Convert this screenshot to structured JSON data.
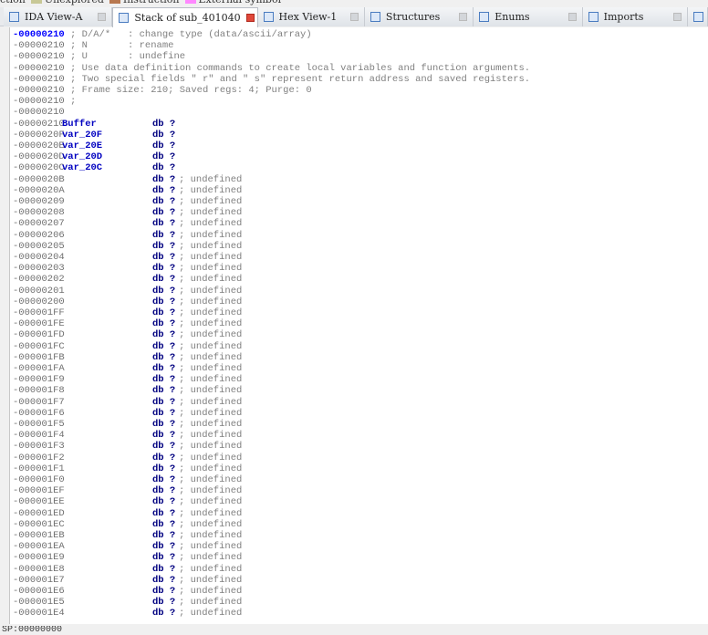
{
  "legend": [
    {
      "label": "ction",
      "color": ""
    },
    {
      "label": "Unexplored",
      "color": "#c8c896"
    },
    {
      "label": "Instruction",
      "color": "#b87850"
    },
    {
      "label": "External symbol",
      "color": "#ff88ff"
    }
  ],
  "tabs": [
    {
      "label": "IDA View-A",
      "active": false
    },
    {
      "label": "Stack of sub_401040",
      "active": true
    },
    {
      "label": "Hex View-1",
      "active": false
    },
    {
      "label": "Structures",
      "active": false
    },
    {
      "label": "Enums",
      "active": false
    },
    {
      "label": "Imports",
      "active": false
    },
    {
      "label": "",
      "active": false
    }
  ],
  "header_lines": [
    {
      "addr": "-00000210",
      "text": " ; D/A/*   : change type (data/ascii/array)"
    },
    {
      "addr": "-00000210",
      "text": " ; N       : rename"
    },
    {
      "addr": "-00000210",
      "text": " ; U       : undefine"
    },
    {
      "addr": "-00000210",
      "text": " ; Use data definition commands to create local variables and function arguments."
    },
    {
      "addr": "-00000210",
      "text": " ; Two special fields \" r\" and \" s\" represent return address and saved registers."
    },
    {
      "addr": "-00000210",
      "text": " ; Frame size: 210; Saved regs: 4; Purge: 0"
    },
    {
      "addr": "-00000210",
      "text": " ;"
    },
    {
      "addr": "-00000210",
      "text": ""
    }
  ],
  "vars": [
    {
      "addr": "-00000210",
      "name": "Buffer",
      "type": "db ?"
    },
    {
      "addr": "-0000020F",
      "name": "var_20F",
      "type": "db ?"
    },
    {
      "addr": "-0000020E",
      "name": "var_20E",
      "type": "db ?"
    },
    {
      "addr": "-0000020D",
      "name": "var_20D",
      "type": "db ?"
    },
    {
      "addr": "-0000020C",
      "name": "var_20C",
      "type": "db ?"
    }
  ],
  "undefined_type": "db ?",
  "undefined_comment": "; undefined",
  "undefined_addrs": [
    "-0000020B",
    "-0000020A",
    "-00000209",
    "-00000208",
    "-00000207",
    "-00000206",
    "-00000205",
    "-00000204",
    "-00000203",
    "-00000202",
    "-00000201",
    "-00000200",
    "-000001FF",
    "-000001FE",
    "-000001FD",
    "-000001FC",
    "-000001FB",
    "-000001FA",
    "-000001F9",
    "-000001F8",
    "-000001F7",
    "-000001F6",
    "-000001F5",
    "-000001F4",
    "-000001F3",
    "-000001F2",
    "-000001F1",
    "-000001F0",
    "-000001EF",
    "-000001EE",
    "-000001ED",
    "-000001EC",
    "-000001EB",
    "-000001EA",
    "-000001E9",
    "-000001E8",
    "-000001E7",
    "-000001E6",
    "-000001E5",
    "-000001E4"
  ],
  "status": "SP:00000000"
}
